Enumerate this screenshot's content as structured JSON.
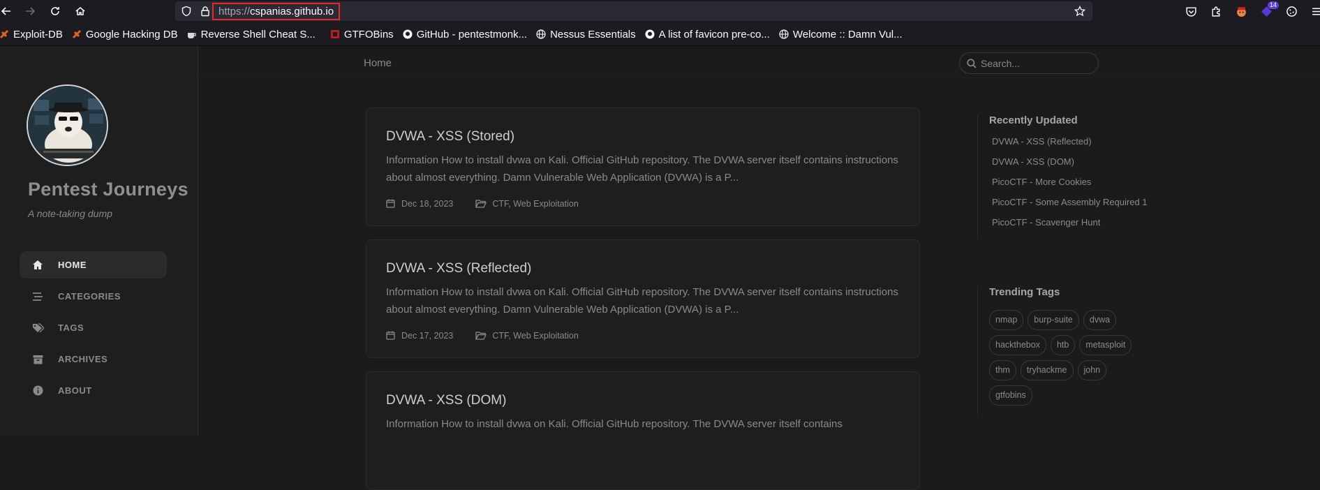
{
  "browser": {
    "url_scheme": "https://",
    "url_host": "cspanias.github.io",
    "extension_badge": "14"
  },
  "bookmarks": [
    {
      "label": "Exploit-DB",
      "icon": "exploitdb-icon",
      "color": "#e0631e"
    },
    {
      "label": "Google Hacking DB",
      "icon": "ghdb-icon",
      "color": "#e0631e"
    },
    {
      "label": "Reverse Shell Cheat S...",
      "icon": "cup-icon",
      "color": "#d8d8d8"
    },
    {
      "label": "GTFOBins",
      "icon": "gtfobins-icon",
      "color": "#b41e1e"
    },
    {
      "label": "GitHub - pentestmonk...",
      "icon": "github-icon",
      "color": "#fbfbfe"
    },
    {
      "label": "Nessus Essentials",
      "icon": "globe-icon",
      "color": "#fbfbfe"
    },
    {
      "label": "A list of favicon pre-co...",
      "icon": "github-icon",
      "color": "#fbfbfe"
    },
    {
      "label": "Welcome :: Damn Vul...",
      "icon": "globe-icon",
      "color": "#fbfbfe"
    }
  ],
  "site": {
    "title": "Pentest Journeys",
    "subtitle": "A note-taking dump"
  },
  "nav": [
    {
      "label": "HOME",
      "icon": "home-icon",
      "active": true
    },
    {
      "label": "CATEGORIES",
      "icon": "stream-icon",
      "active": false
    },
    {
      "label": "TAGS",
      "icon": "tags-icon",
      "active": false
    },
    {
      "label": "ARCHIVES",
      "icon": "archive-icon",
      "active": false
    },
    {
      "label": "ABOUT",
      "icon": "info-icon",
      "active": false
    }
  ],
  "breadcrumb": "Home",
  "search": {
    "placeholder": "Search..."
  },
  "posts": [
    {
      "title": "DVWA - XSS (Stored)",
      "excerpt": "Information How to install dvwa on Kali. Official GitHub repository. The DVWA server itself contains instructions about almost everything. Damn Vulnerable Web Application (DVWA) is a P...",
      "date": "Dec 18, 2023",
      "categories": "CTF, Web Exploitation"
    },
    {
      "title": "DVWA - XSS (Reflected)",
      "excerpt": "Information How to install dvwa on Kali. Official GitHub repository. The DVWA server itself contains instructions about almost everything. Damn Vulnerable Web Application (DVWA) is a P...",
      "date": "Dec 17, 2023",
      "categories": "CTF, Web Exploitation"
    },
    {
      "title": "DVWA - XSS (DOM)",
      "excerpt": "Information How to install dvwa on Kali. Official GitHub repository. The DVWA server itself contains",
      "date": "",
      "categories": ""
    }
  ],
  "recently_updated": {
    "heading": "Recently Updated",
    "items": [
      "DVWA - XSS (Reflected)",
      "DVWA - XSS (DOM)",
      "PicoCTF - More Cookies",
      "PicoCTF - Some Assembly Required 1",
      "PicoCTF - Scavenger Hunt"
    ]
  },
  "trending_tags": {
    "heading": "Trending Tags",
    "tags": [
      "nmap",
      "burp-suite",
      "dvwa",
      "hackthebox",
      "htb",
      "metasploit",
      "thm",
      "tryhackme",
      "john",
      "gtfobins"
    ]
  }
}
